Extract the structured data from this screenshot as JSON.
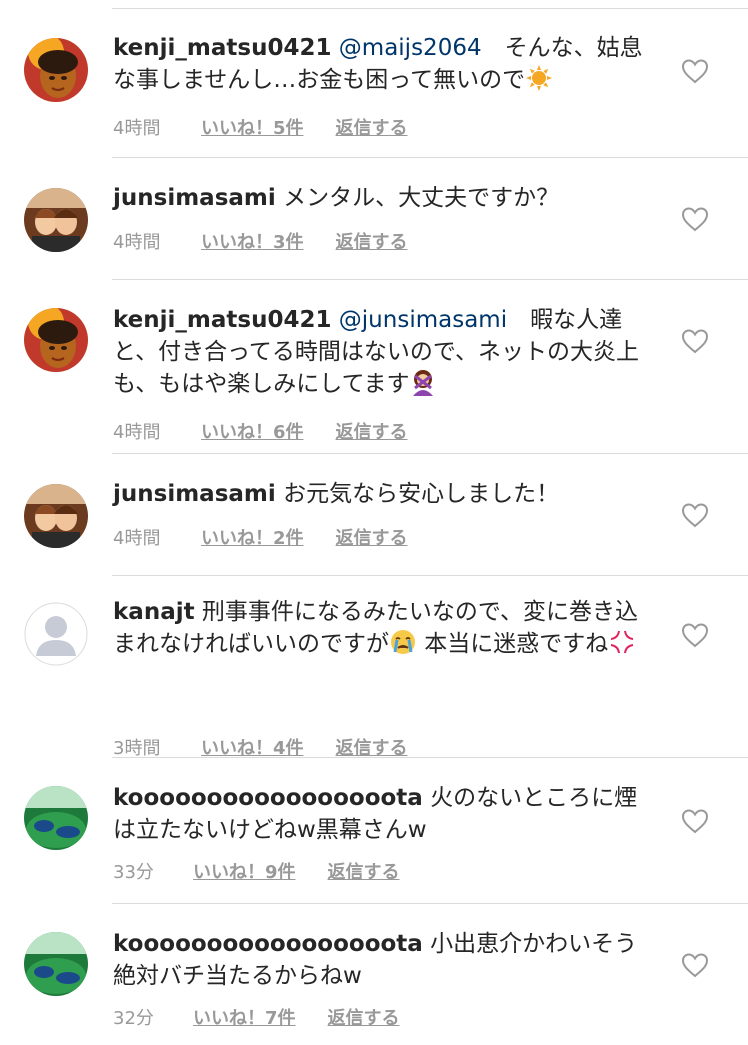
{
  "comments": [
    {
      "username": "kenji_matsu0421",
      "mention": "@maijs2064",
      "text": "　そんな、姑息な事しませんし…お金も困って無いので",
      "emoji": "sun-emoji",
      "time": "4時間",
      "likes": "いいね！5件",
      "reply": "返信する",
      "avatar": "avatar-kenji"
    },
    {
      "username": "junsimasami",
      "mention": "",
      "text": "メンタル、大丈夫ですか？",
      "emoji": "",
      "time": "4時間",
      "likes": "いいね！3件",
      "reply": "返信する",
      "avatar": "avatar-junsi"
    },
    {
      "username": "kenji_matsu0421",
      "mention": "@junsimasami",
      "text": "　暇な人達と、付き合ってる時間はないので、ネットの大炎上も、もはや楽しみにしてます",
      "emoji": "person-gesturing-no-emoji",
      "time": "4時間",
      "likes": "いいね！6件",
      "reply": "返信する",
      "avatar": "avatar-kenji"
    },
    {
      "username": "junsimasami",
      "mention": "",
      "text": "お元気なら安心しました！",
      "emoji": "",
      "time": "4時間",
      "likes": "いいね！2件",
      "reply": "返信する",
      "avatar": "avatar-junsi"
    },
    {
      "username": "kanajt",
      "mention": "",
      "text": "刑事事件になるみたいなので、変に巻き込まれなければいいのですが",
      "text2": " 本当に迷惑ですね",
      "emoji": "crying-face-emoji",
      "emoji2": "anger-symbol-emoji",
      "time": "3時間",
      "likes": "いいね！4件",
      "reply": "返信する",
      "avatar": "avatar-default"
    },
    {
      "username": "kooooooooooooooooota",
      "mention": "",
      "text": "火のないところに煙は立たないけどねw黒幕さんw",
      "emoji": "",
      "time": "33分",
      "likes": "いいね！9件",
      "reply": "返信する",
      "avatar": "avatar-koota"
    },
    {
      "username": "kooooooooooooooooota",
      "mention": "",
      "text": "小出恵介かわいそう絶対バチ当たるからねw",
      "emoji": "",
      "time": "32分",
      "likes": "いいね！7件",
      "reply": "返信する",
      "avatar": "avatar-koota"
    }
  ],
  "colors": {
    "text": "#262626",
    "meta": "#999999",
    "mention": "#003569",
    "divider": "#dbdbdb"
  },
  "icons": {
    "like": "heart-outline-icon"
  }
}
